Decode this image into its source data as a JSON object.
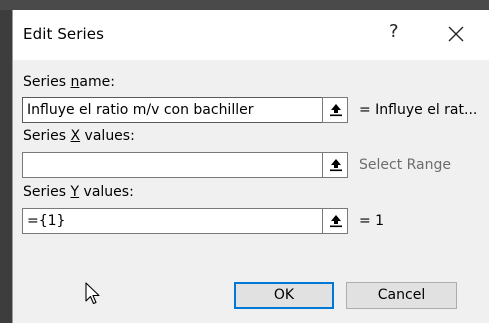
{
  "dialog": {
    "title": "Edit Series",
    "help_label": "?",
    "close_icon": "close-icon"
  },
  "series_name": {
    "label_prefix": "Series ",
    "label_accel": "n",
    "label_suffix": "ame:",
    "value": "Influye el ratio m/v con bachiller",
    "preview": "= Influye el rat..."
  },
  "series_x": {
    "label_prefix": "Series ",
    "label_accel": "X",
    "label_suffix": " values:",
    "value": "",
    "preview": "Select Range"
  },
  "series_y": {
    "label_prefix": "Series ",
    "label_accel": "Y",
    "label_suffix": " values:",
    "value": "={1}",
    "preview": "= 1"
  },
  "buttons": {
    "ok": "OK",
    "cancel": "Cancel"
  },
  "icons": {
    "range_select": "collapse-range-icon",
    "pointer": "mouse-pointer-icon"
  }
}
